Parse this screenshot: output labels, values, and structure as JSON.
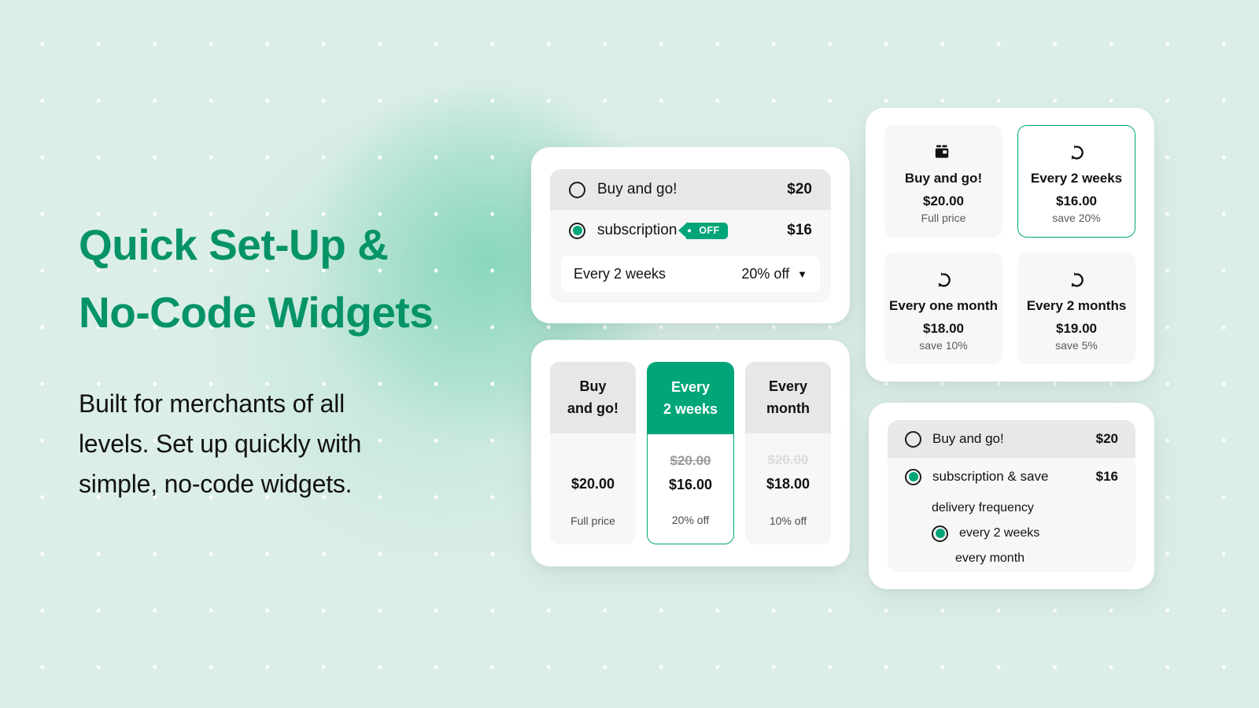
{
  "theme": {
    "accent_green": "#00a578",
    "heading_green": "#069368",
    "background": "#dceee8",
    "text_dark": "#121212"
  },
  "hero": {
    "headline_line1": "Quick Set-Up &",
    "headline_line2": "No-Code Widgets",
    "subcopy_line1": "Built for merchants of all",
    "subcopy_line2": "levels. Set up quickly with",
    "subcopy_line3": "simple, no-code widgets."
  },
  "widget_radio_basic": {
    "option_one": {
      "label": "Buy and go!",
      "price": "$20"
    },
    "option_two": {
      "label": "subscription",
      "badge": "OFF",
      "price": "$16"
    },
    "frequency_select": {
      "label": "Every 2 weeks",
      "value": "20% off",
      "caret": "▼"
    }
  },
  "widget_columns": {
    "columns": [
      {
        "title_line1": "Buy",
        "title_line2": "and go!",
        "strike_price": "",
        "price": "$20.00",
        "note": "Full price",
        "selected": false,
        "strike_style": "none"
      },
      {
        "title_line1": "Every",
        "title_line2": "2 weeks",
        "strike_price": "$20.00",
        "price": "$16.00",
        "note": "20% off",
        "selected": true,
        "strike_style": "normal"
      },
      {
        "title_line1": "Every",
        "title_line2": "month",
        "strike_price": "$20.00",
        "price": "$18.00",
        "note": "10% off",
        "selected": false,
        "strike_style": "faded"
      }
    ]
  },
  "widget_tiles": {
    "tiles": [
      {
        "icon": "box-icon",
        "title": "Buy and go!",
        "price": "$20.00",
        "note": "Full price",
        "selected": false
      },
      {
        "icon": "cycle-icon",
        "title": "Every 2 weeks",
        "price": "$16.00",
        "note": "save 20%",
        "selected": true
      },
      {
        "icon": "cycle-icon",
        "title": "Every one month",
        "price": "$18.00",
        "note": "save 10%",
        "selected": false
      },
      {
        "icon": "cycle-icon",
        "title": "Every 2 months",
        "price": "$19.00",
        "note": "save 5%",
        "selected": false
      }
    ]
  },
  "widget_nested": {
    "option_one": {
      "label": "Buy and go!",
      "price": "$20"
    },
    "option_two": {
      "label": "subscription & save",
      "price": "$16"
    },
    "sub_heading": "delivery frequency",
    "sub_options": [
      {
        "label": "every 2 weeks",
        "selected": true
      },
      {
        "label": "every month",
        "selected": false
      }
    ]
  }
}
